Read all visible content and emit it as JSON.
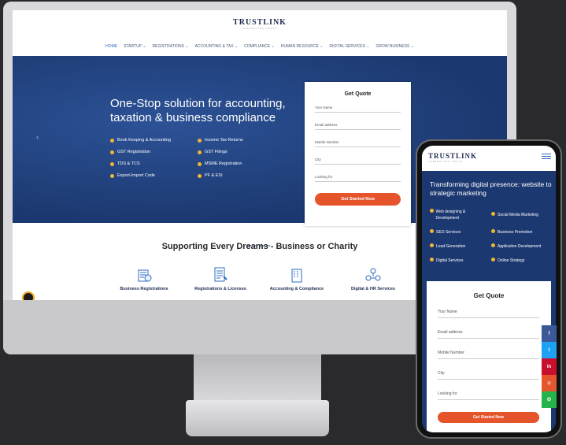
{
  "desktop": {
    "brand": "TRUSTLINK",
    "brand_sub": "SUPPORTING TRUST",
    "nav": [
      "HOME",
      "STARTUP ⌄",
      "REGISTRATIONS ⌄",
      "ACCOUNTING & TAX ⌄",
      "COMPLIANCE ⌄",
      "HUMAN RESOURCE ⌄",
      "DIGITAL SERVICES ⌄",
      "GROW BUSINESS ⌄"
    ],
    "hero_title": "One-Stop solution for accounting, taxation & business compliance",
    "features_left": [
      "Book Keeping & Accounting",
      "GST Registration",
      "TDS & TCS",
      "Export-Import Code"
    ],
    "features_right": [
      "Income Tax Returns",
      "GST Filings",
      "MSME Registration",
      "PF & ESI"
    ],
    "quote": {
      "title": "Get Quote",
      "fields": [
        "Your Name",
        "Email address",
        "Mobile Number",
        "City",
        "Looking for"
      ],
      "button": "Get Started Now"
    },
    "section_title": "Supporting Every Dreams - Business or Charity",
    "services": [
      "Business Registrations",
      "Registrations & Licenses",
      "Accounting & Compliance",
      "Digital & HR Services"
    ],
    "accent": "#e6542c",
    "hero_color": "#1c3870"
  },
  "mobile": {
    "brand": "TRUSTLINK",
    "brand_sub": "SUPPORTING TRUST",
    "hero_title": "Transforming digital presence: website to strategic marketing",
    "features_left": [
      "Web designing & Development",
      "SEO Services",
      "Lead Generation",
      "Digital Services"
    ],
    "features_right": [
      "Social Media Marketing",
      "Business Promotion",
      "Application Development",
      "Online Strategy"
    ],
    "quote": {
      "title": "Get Quote",
      "fields": [
        "Your Name",
        "Email address",
        "Mobile Number",
        "City",
        "Looking for"
      ],
      "button": "Get Started Now"
    },
    "social": [
      {
        "icon": "facebook-icon",
        "glyph": "f",
        "color": "#3b5998"
      },
      {
        "icon": "twitter-icon",
        "glyph": "t",
        "color": "#1da1f2"
      },
      {
        "icon": "linkedin-icon",
        "glyph": "in",
        "color": "#c8102e"
      },
      {
        "icon": "instagram-icon",
        "glyph": "◘",
        "color": "#e4572e"
      },
      {
        "icon": "whatsapp-icon",
        "glyph": "✆",
        "color": "#25b34b"
      }
    ]
  }
}
